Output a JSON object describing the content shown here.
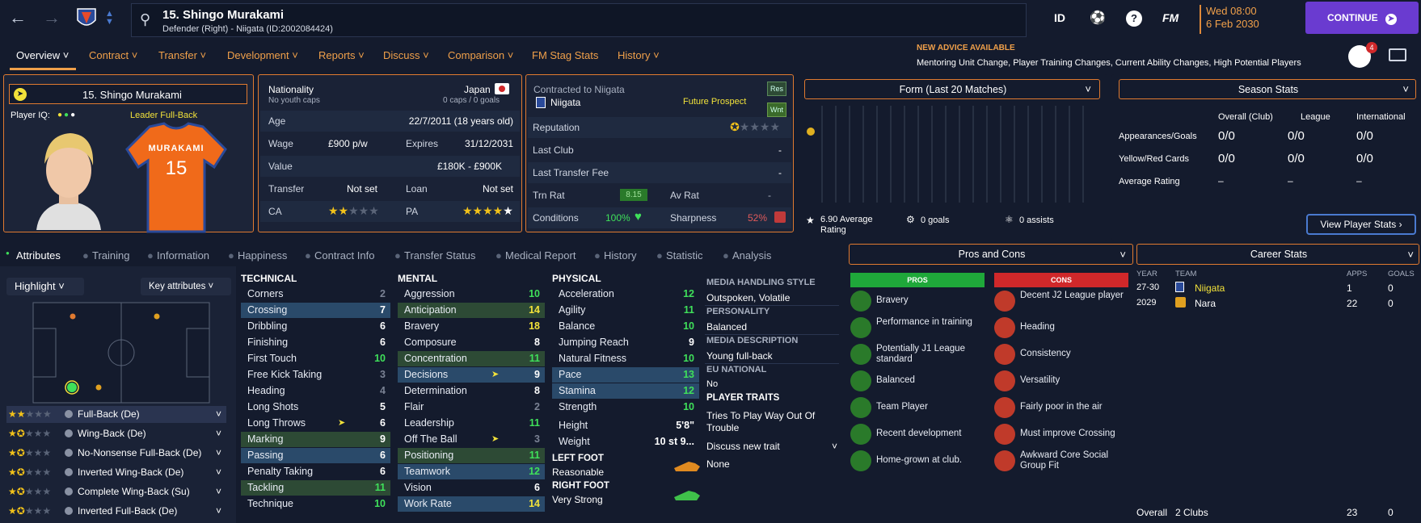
{
  "topbar": {
    "player_name": "15. Shingo Murakami",
    "player_sub": "Defender (Right) - Niigata (ID:2002084424)",
    "icons": [
      "back-icon",
      "forward-icon",
      "club-crest-icon",
      "search-icon"
    ],
    "id_label": "ID",
    "fm_label": "FM",
    "date_day": "Wed 08:00",
    "date_full": "6 Feb 2030",
    "continue_label": "CONTINUE",
    "badge_count": "4"
  },
  "menu": {
    "items": [
      "Overview",
      "Contract",
      "Transfer",
      "Development",
      "Reports",
      "Discuss",
      "Comparison",
      "FM Stag Stats",
      "History"
    ],
    "advice_title": "NEW ADVICE AVAILABLE",
    "advice_text": "Mentoring Unit Change, Player Training Changes, Current Ability Changes, High Potential Players"
  },
  "profile": {
    "name": "15. Shingo Murakami",
    "iq_label": "Player IQ:",
    "role_tag": "Leader Full-Back",
    "shirt_name": "MURAKAMI",
    "shirt_number": "15"
  },
  "info": {
    "nationality_label": "Nationality",
    "nationality": "Japan",
    "youth_caps": "No youth caps",
    "caps": "0 caps / 0 goals",
    "age_label": "Age",
    "age": "22/7/2011 (18 years old)",
    "wage_label": "Wage",
    "wage": "£900 p/w",
    "expires_label": "Expires",
    "expires": "31/12/2031",
    "value_label": "Value",
    "value": "£180K - £900K",
    "transfer_label": "Transfer",
    "transfer": "Not set",
    "loan_label": "Loan",
    "loan": "Not set",
    "ca_label": "CA",
    "pa_label": "PA",
    "ca_stars": 2,
    "pa_stars": 4
  },
  "contract": {
    "contracted_label": "Contracted to Niigata",
    "club": "Niigata",
    "prospect": "Future Prospect",
    "res": "Res",
    "wnt": "Wnt",
    "reputation_label": "Reputation",
    "reputation_stars": 0.5,
    "last_club_label": "Last Club",
    "last_club": "-",
    "last_fee_label": "Last Transfer Fee",
    "last_fee": "-",
    "trn_rat_label": "Trn Rat",
    "trn_rat": "8.15",
    "av_rat_label": "Av Rat",
    "av_rat": "-",
    "conditions_label": "Conditions",
    "conditions": "100%",
    "sharpness_label": "Sharpness",
    "sharpness": "52%"
  },
  "form": {
    "title": "Form (Last 20 Matches)",
    "avg_rating": "6.90 Average Rating",
    "goals": "0 goals",
    "assists": "0 assists"
  },
  "season": {
    "title": "Season Stats",
    "cols": [
      "Overall (Club)",
      "League",
      "International"
    ],
    "rows": [
      {
        "label": "Appearances/Goals",
        "values": [
          "0/0",
          "0/0",
          "0/0"
        ]
      },
      {
        "label": "Yellow/Red Cards",
        "values": [
          "0/0",
          "0/0",
          "0/0"
        ]
      },
      {
        "label": "Average Rating",
        "values": [
          "–",
          "–",
          "–"
        ]
      }
    ],
    "view_btn": "View Player Stats"
  },
  "subtabs": [
    "Attributes",
    "Training",
    "Information",
    "Happiness",
    "Contract Info",
    "Transfer Status",
    "Medical Report",
    "History",
    "Statistic",
    "Analysis"
  ],
  "pitch": {
    "highlight": "Highlight",
    "key_attributes": "Key attributes",
    "roles": [
      {
        "name": "Full-Back (De)",
        "stars": 2
      },
      {
        "name": "Wing-Back (De)",
        "stars": 1.5
      },
      {
        "name": "No-Nonsense Full-Back (De)",
        "stars": 1.5
      },
      {
        "name": "Inverted Wing-Back (De)",
        "stars": 1.5
      },
      {
        "name": "Complete Wing-Back (Su)",
        "stars": 1.5
      },
      {
        "name": "Inverted Full-Back (De)",
        "stars": 1.5
      }
    ]
  },
  "technical": {
    "title": "TECHNICAL",
    "attrs": [
      {
        "name": "Corners",
        "v": "2",
        "c": "d",
        "h": ""
      },
      {
        "name": "Crossing",
        "v": "7",
        "c": "w",
        "h": "hl"
      },
      {
        "name": "Dribbling",
        "v": "6",
        "c": "w",
        "h": ""
      },
      {
        "name": "Finishing",
        "v": "6",
        "c": "w",
        "h": ""
      },
      {
        "name": "First Touch",
        "v": "10",
        "c": "g",
        "h": ""
      },
      {
        "name": "Free Kick Taking",
        "v": "3",
        "c": "d",
        "h": ""
      },
      {
        "name": "Heading",
        "v": "4",
        "c": "d",
        "h": ""
      },
      {
        "name": "Long Shots",
        "v": "5",
        "c": "w",
        "h": ""
      },
      {
        "name": "Long Throws",
        "v": "6",
        "c": "w",
        "h": ""
      },
      {
        "name": "Marking",
        "v": "9",
        "c": "w",
        "h": "hlg"
      },
      {
        "name": "Passing",
        "v": "6",
        "c": "w",
        "h": "hl"
      },
      {
        "name": "Penalty Taking",
        "v": "6",
        "c": "w",
        "h": ""
      },
      {
        "name": "Tackling",
        "v": "11",
        "c": "g",
        "h": "hlg"
      },
      {
        "name": "Technique",
        "v": "10",
        "c": "g",
        "h": ""
      }
    ]
  },
  "mental": {
    "title": "MENTAL",
    "attrs": [
      {
        "name": "Aggression",
        "v": "10",
        "c": "g",
        "h": ""
      },
      {
        "name": "Anticipation",
        "v": "14",
        "c": "y",
        "h": "hlg"
      },
      {
        "name": "Bravery",
        "v": "18",
        "c": "y",
        "h": ""
      },
      {
        "name": "Composure",
        "v": "8",
        "c": "w",
        "h": ""
      },
      {
        "name": "Concentration",
        "v": "11",
        "c": "g",
        "h": "hlg"
      },
      {
        "name": "Decisions",
        "v": "9",
        "c": "w",
        "h": "hl"
      },
      {
        "name": "Determination",
        "v": "8",
        "c": "w",
        "h": ""
      },
      {
        "name": "Flair",
        "v": "2",
        "c": "d",
        "h": ""
      },
      {
        "name": "Leadership",
        "v": "11",
        "c": "g",
        "h": ""
      },
      {
        "name": "Off The Ball",
        "v": "3",
        "c": "d",
        "h": ""
      },
      {
        "name": "Positioning",
        "v": "11",
        "c": "g",
        "h": "hlg"
      },
      {
        "name": "Teamwork",
        "v": "12",
        "c": "g",
        "h": "hl"
      },
      {
        "name": "Vision",
        "v": "6",
        "c": "w",
        "h": ""
      },
      {
        "name": "Work Rate",
        "v": "14",
        "c": "y",
        "h": "hl"
      }
    ]
  },
  "physical": {
    "title": "PHYSICAL",
    "attrs": [
      {
        "name": "Acceleration",
        "v": "12",
        "c": "g",
        "h": ""
      },
      {
        "name": "Agility",
        "v": "11",
        "c": "g",
        "h": ""
      },
      {
        "name": "Balance",
        "v": "10",
        "c": "g",
        "h": ""
      },
      {
        "name": "Jumping Reach",
        "v": "9",
        "c": "w",
        "h": ""
      },
      {
        "name": "Natural Fitness",
        "v": "10",
        "c": "g",
        "h": ""
      },
      {
        "name": "Pace",
        "v": "13",
        "c": "g",
        "h": "hl"
      },
      {
        "name": "Stamina",
        "v": "12",
        "c": "g",
        "h": "hl"
      },
      {
        "name": "Strength",
        "v": "10",
        "c": "g",
        "h": ""
      }
    ],
    "height_label": "Height",
    "height": "5'8\"",
    "weight_label": "Weight",
    "weight": "10 st 9...",
    "left_foot_label": "LEFT FOOT",
    "left_foot": "Reasonable",
    "right_foot_label": "RIGHT FOOT",
    "right_foot": "Very Strong"
  },
  "media": {
    "style_label": "MEDIA HANDLING STYLE",
    "style": "Outspoken, Volatile",
    "personality_label": "PERSONALITY",
    "personality": "Balanced",
    "description_label": "MEDIA DESCRIPTION",
    "description": "Young full-back",
    "eu_label": "EU NATIONAL",
    "eu": "No",
    "traits_label": "PLAYER TRAITS",
    "trait": "Tries To Play Way Out Of Trouble",
    "discuss": "Discuss new trait",
    "none": "None"
  },
  "proscons": {
    "title": "Pros and Cons",
    "pros_label": "PROS",
    "cons_label": "CONS",
    "pros": [
      "Bravery",
      "Performance in training",
      "Potentially J1 League standard",
      "Balanced",
      "Team Player",
      "Recent development",
      "Home-grown at club."
    ],
    "cons": [
      "Decent J2 League player",
      "Heading",
      "Consistency",
      "Versatility",
      "Fairly poor in the air",
      "Must improve Crossing",
      "Awkward Core Social Group Fit"
    ]
  },
  "career": {
    "title": "Career Stats",
    "cols": [
      "YEAR",
      "TEAM",
      "APPS",
      "GOALS"
    ],
    "rows": [
      {
        "year": "27-30",
        "team": "Niigata",
        "apps": "1",
        "goals": "0"
      },
      {
        "year": "2029",
        "team": "Nara",
        "apps": "22",
        "goals": "0"
      }
    ],
    "overall_label": "Overall",
    "clubs": "2 Clubs",
    "total_apps": "23",
    "total_goals": "0"
  },
  "colors": {
    "accent": "#f0a04a",
    "green": "#3fe05a",
    "yellow": "#f2e23a",
    "purple": "#6a3bd0",
    "pros": "#1fa83a",
    "cons": "#d0282a"
  }
}
